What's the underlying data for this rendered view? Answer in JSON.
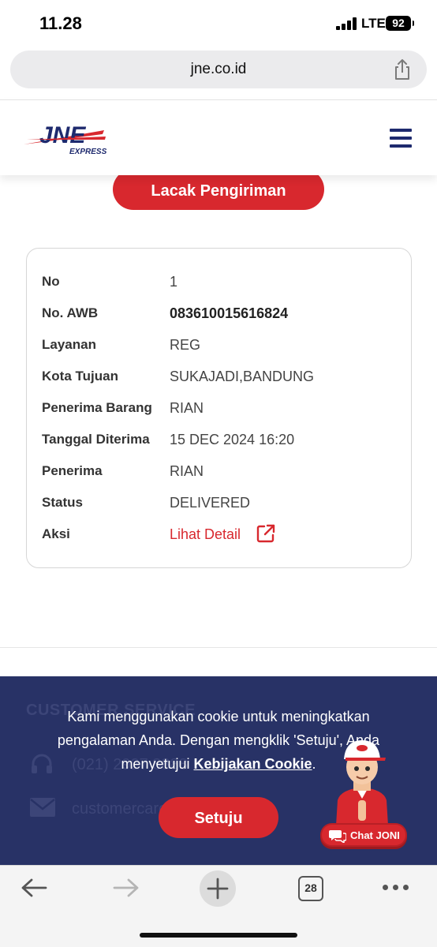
{
  "status_bar": {
    "time": "11.28",
    "network": "LTE",
    "battery": "92"
  },
  "browser": {
    "url": "jne.co.id",
    "tab_count": "28"
  },
  "header": {
    "logo_text": "JNE",
    "logo_subtext": "EXPRESS",
    "brand_colors": {
      "blue": "#1e2a6e",
      "red": "#d8282e"
    }
  },
  "track_button": {
    "label": "Lacak Pengiriman"
  },
  "result": {
    "rows": [
      {
        "label": "No",
        "value": "1"
      },
      {
        "label": "No. AWB",
        "value": "083610015616824"
      },
      {
        "label": "Layanan",
        "value": "REG"
      },
      {
        "label": "Kota Tujuan",
        "value": "SUKAJADI,BANDUNG"
      },
      {
        "label": "Penerima Barang",
        "value": "RIAN"
      },
      {
        "label": "Tanggal Diterima",
        "value": "15 DEC 2024 16:20"
      },
      {
        "label": "Penerima",
        "value": "RIAN"
      },
      {
        "label": "Status",
        "value": "DELIVERED"
      }
    ],
    "action": {
      "label": "Aksi",
      "link_text": "Lihat Detail"
    }
  },
  "footer": {
    "title": "CUSTOMER SERVICE",
    "phone": "(021) 2927 8888",
    "email": "customercare@jne.co.id"
  },
  "cookie_banner": {
    "text_before": "Kami menggunakan cookie untuk meningkatkan pengalaman Anda. Dengan mengklik 'Setuju', Anda menyetujui ",
    "link_text": "Kebijakan Cookie",
    "text_after": ".",
    "agree_label": "Setuju"
  },
  "chat": {
    "label": "Chat JONI"
  }
}
